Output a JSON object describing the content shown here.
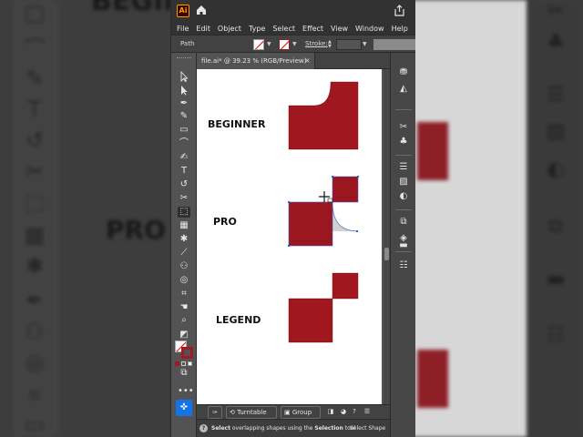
{
  "background": {
    "headline_top": "BEGINNER",
    "headline_mid": "PRO"
  },
  "app": {
    "logo": "Ai",
    "menus": [
      "File",
      "Edit",
      "Object",
      "Type",
      "Select",
      "Effect",
      "View",
      "Window",
      "Help"
    ],
    "control_bar": {
      "selection_type": "Path",
      "stroke_label": "Stroke:"
    },
    "document_tab": {
      "title": "file.ai* @ 39.23 % (RGB/Preview)",
      "close": "×"
    },
    "artboard": {
      "labels": {
        "beginner": "BEGINNER",
        "pro": "PRO",
        "legend": "LEGEND"
      },
      "shape_color": "#a0171f"
    },
    "taskbar": {
      "turntable": "Turntable",
      "group": "Group"
    },
    "status": {
      "help": "?",
      "prefix": "Select",
      "middle": " overlapping shapes using the ",
      "tool": "Selection",
      "suffix": " tool",
      "next": "Select Shape"
    },
    "colors": {
      "accent": "#1473e6",
      "stroke_swatch": "#9e1b26",
      "chrome_dark": "#323232",
      "chrome_mid": "#535353"
    }
  }
}
